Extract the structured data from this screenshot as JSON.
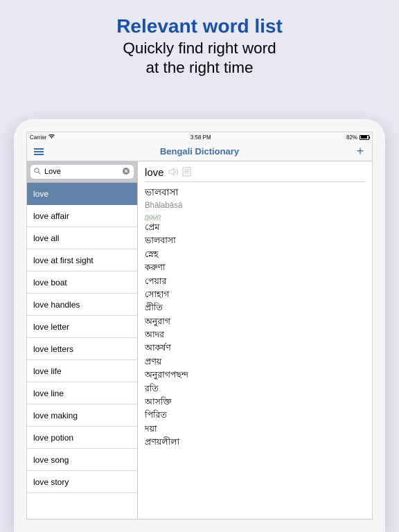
{
  "promo": {
    "title": "Relevant word list",
    "subtitle_line1": "Quickly find right word",
    "subtitle_line2": "at the right time"
  },
  "statusbar": {
    "carrier": "Carrier",
    "time": "3:58 PM",
    "battery": "82%"
  },
  "navbar": {
    "title": "Bengali Dictionary",
    "add_label": "+"
  },
  "search": {
    "value": "Love"
  },
  "word_list": [
    "love",
    "love affair",
    "love all",
    "love at first sight",
    "love boat",
    "love handles",
    "love letter",
    "love letters",
    "love life",
    "love line",
    "love making",
    "love potion",
    "love song",
    "love story"
  ],
  "selected_index": 0,
  "detail": {
    "headword": "love",
    "main_translation": "ভালবাসা",
    "transliteration": "Bhālabāsā",
    "pos": "noun",
    "translations": [
      "প্রেম",
      "ভালবাসা",
      "স্নেহ",
      "করুণা",
      "পেয়ার",
      "সোহাগ",
      "প্রীতি",
      "অনুরাগ",
      "আদর",
      "আকর্ষণ",
      "প্রণয়",
      "অনুরাগপছন্দ",
      "রতি",
      "আসক্তি",
      "পিরিত",
      "দয়া",
      "প্রণয়লীলা"
    ]
  }
}
